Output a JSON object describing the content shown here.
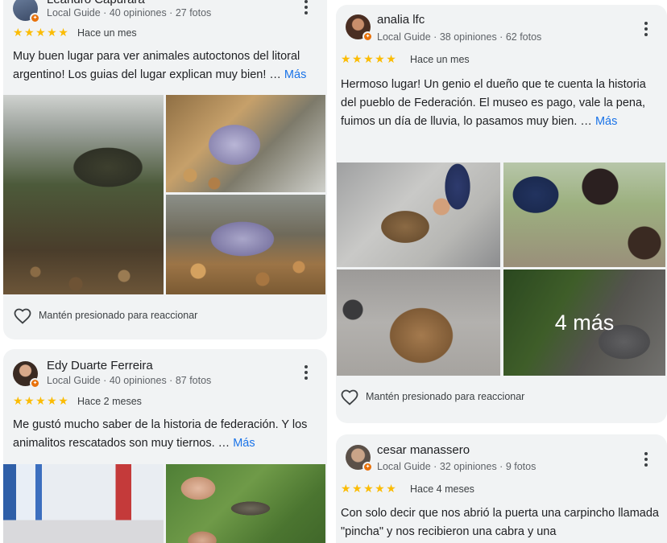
{
  "reviews": [
    {
      "name": "Leandro Capurara",
      "meta": "Local Guide · 40 opiniones · 27 fotos",
      "stars": "★★★★★",
      "when": "Hace un mes",
      "text": "Muy buen lugar para ver animales autoctonos del litoral argentino! Los guias del lugar explican muy bien! … ",
      "more": "Más",
      "react": "Mantén presionado para reaccionar"
    },
    {
      "name": "Edy Duarte Ferreira",
      "meta": "Local Guide · 40 opiniones · 87 fotos",
      "stars": "★★★★★",
      "when": "Hace 2 meses",
      "text": "Me gustó mucho saber de la historia de federación. Y los animalitos rescatados son muy tiernos. … ",
      "more": "Más"
    },
    {
      "name": "analia lfc",
      "meta": "Local Guide · 38 opiniones · 62 fotos",
      "stars": "★★★★★",
      "when": "Hace un mes",
      "text": "Hermoso lugar! Un genio el dueño que te cuenta la historia del pueblo de Federación. El museo es pago, vale la pena, fuimos un día de lluvia, lo pasamos muy bien. … ",
      "more": "Más",
      "more_photos": "4 más",
      "react": "Mantén presionado para reaccionar"
    },
    {
      "name": "cesar manassero",
      "meta": "Local Guide · 32 opiniones · 9 fotos",
      "stars": "★★★★★",
      "when": "Hace 4 meses",
      "text": "Con solo decir que nos abrió la puerta una carpincho llamada \"pincha\" y nos recibieron una cabra y una"
    }
  ],
  "icons": {
    "more": "more-vert-icon",
    "heart": "heart-outline-icon",
    "badge": "local-guide-badge-icon"
  },
  "colors": {
    "card_bg": "#f1f3f4",
    "star": "#fbbc04",
    "link": "#1a73e8",
    "meta": "#5f6368"
  }
}
